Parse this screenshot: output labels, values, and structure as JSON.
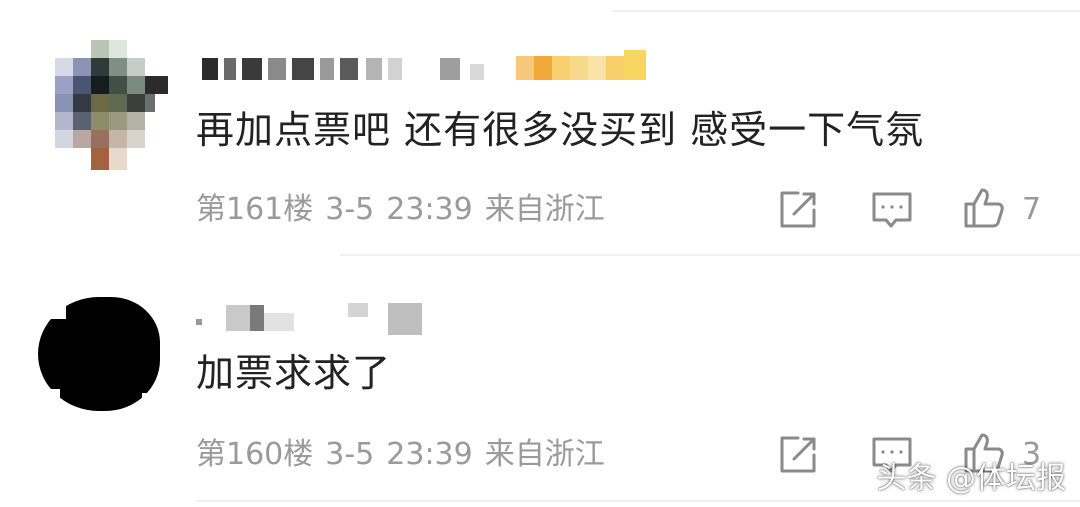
{
  "comments": [
    {
      "text": "再加点票吧 还有很多没买到 感受一下气氛",
      "floor": "第161楼",
      "date": "3-5",
      "time": "23:39",
      "location": "来自浙江",
      "likes": "7"
    },
    {
      "text": "加票求求了",
      "floor": "第160楼",
      "date": "3-5",
      "time": "23:39",
      "location": "来自浙江",
      "likes": "3"
    }
  ],
  "icons": {
    "repost": "edit-share-icon",
    "reply": "comment-bubble-icon",
    "like": "thumbs-up-icon"
  },
  "colors": {
    "text": "#222222",
    "meta": "#9a9a9a",
    "icon": "#8a8a8a",
    "divider": "#f0f0f0"
  },
  "watermark": {
    "text": "头条 @体坛报"
  }
}
